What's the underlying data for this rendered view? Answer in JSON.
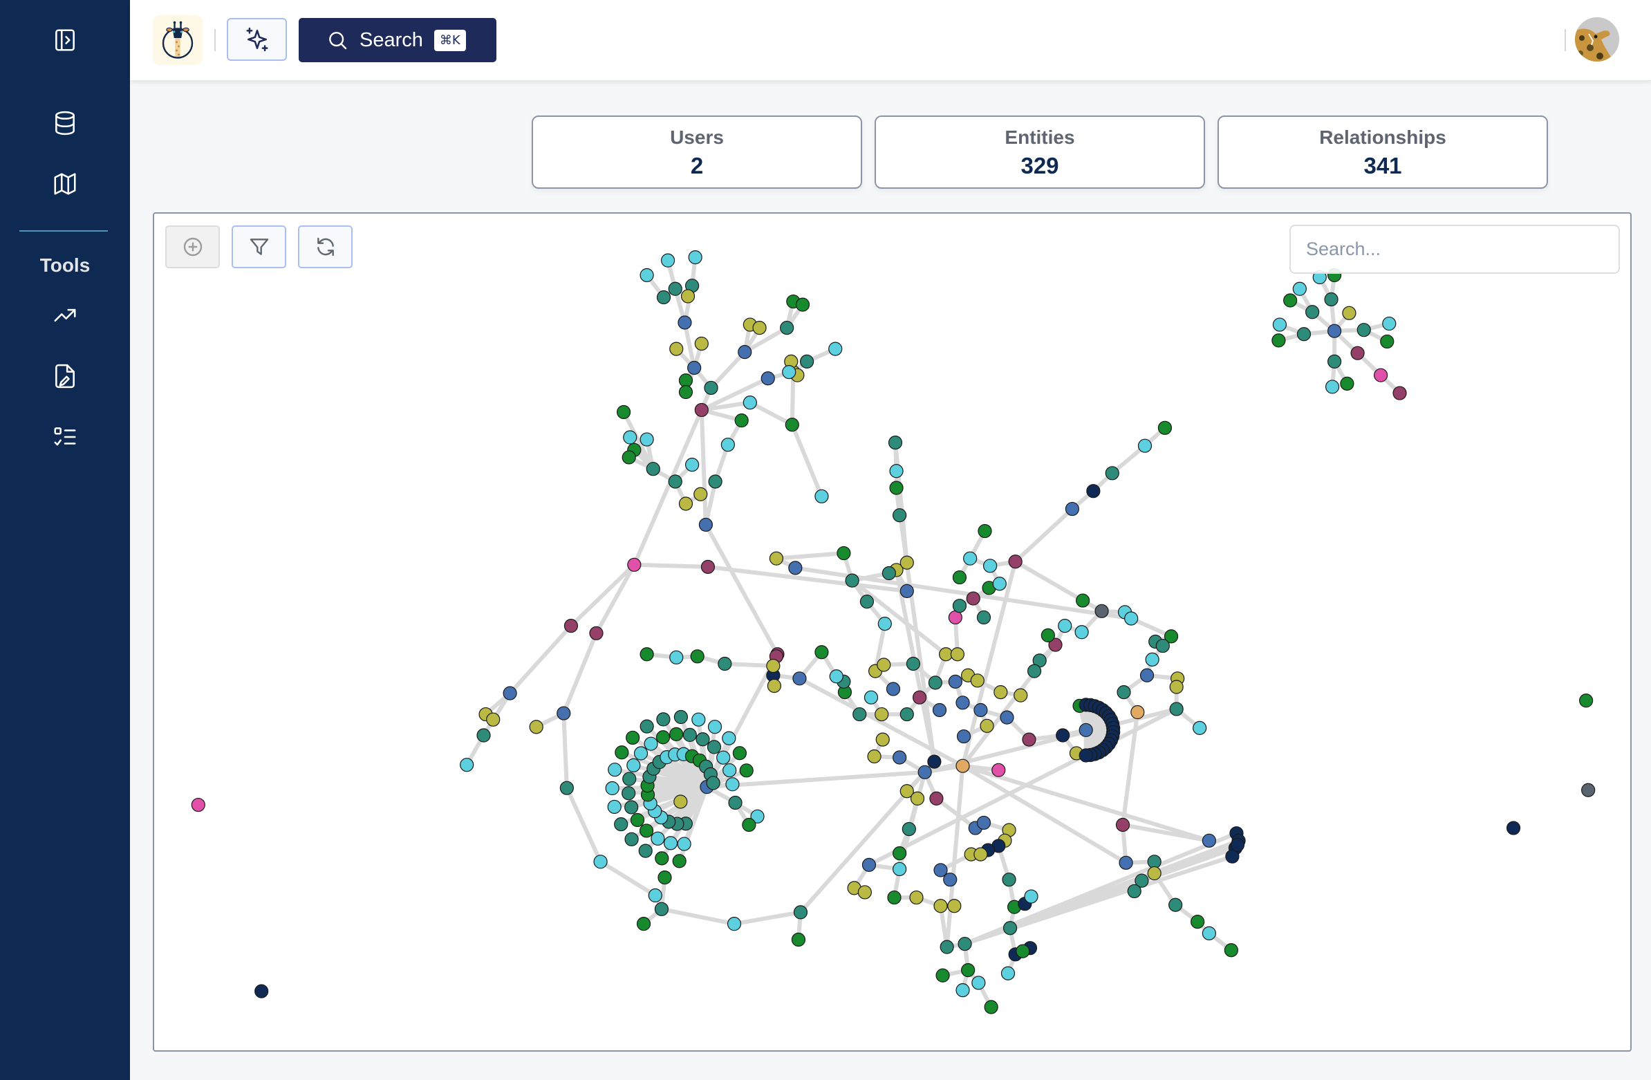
{
  "sidebar": {
    "top_items": [
      {
        "name": "toggle-sidebar",
        "icon": "panel-right-open-icon"
      },
      {
        "name": "database",
        "icon": "database-icon"
      },
      {
        "name": "map",
        "icon": "map-icon"
      }
    ],
    "section_title": "Tools",
    "tool_items": [
      {
        "name": "trending",
        "icon": "trending-up-icon"
      },
      {
        "name": "edit-document",
        "icon": "file-edit-icon"
      },
      {
        "name": "checklist",
        "icon": "list-checks-icon"
      }
    ]
  },
  "header": {
    "logo_icon": "giraffe-logo-icon",
    "ai_button_icon": "sparkles-icon",
    "search_label": "Search",
    "search_shortcut": "⌘K",
    "avatar_alt": "user-avatar"
  },
  "stats": [
    {
      "label": "Users",
      "value": "2"
    },
    {
      "label": "Entities",
      "value": "329"
    },
    {
      "label": "Relationships",
      "value": "341"
    }
  ],
  "graph": {
    "toolbar": [
      {
        "name": "add-node-button",
        "icon": "plus-circle-icon",
        "enabled": false
      },
      {
        "name": "filter-button",
        "icon": "filter-icon",
        "enabled": true
      },
      {
        "name": "refresh-button",
        "icon": "refresh-icon",
        "enabled": true
      }
    ],
    "search_placeholder": "Search...",
    "search_value": "",
    "group_colors": {
      "cyan": "#5dd0e0",
      "teal": "#2e8b7a",
      "green": "#168a2c",
      "olive": "#b9b944",
      "blue": "#4470b0",
      "maroon": "#944068",
      "pink": "#e050a8",
      "navy": "#0f2a55",
      "orange": "#e0a860",
      "gray": "#5a6470"
    },
    "edge_color": "#d9d9d9",
    "node_stroke": "#1a1a1a",
    "total_nodes": 329,
    "total_edges": 341
  }
}
